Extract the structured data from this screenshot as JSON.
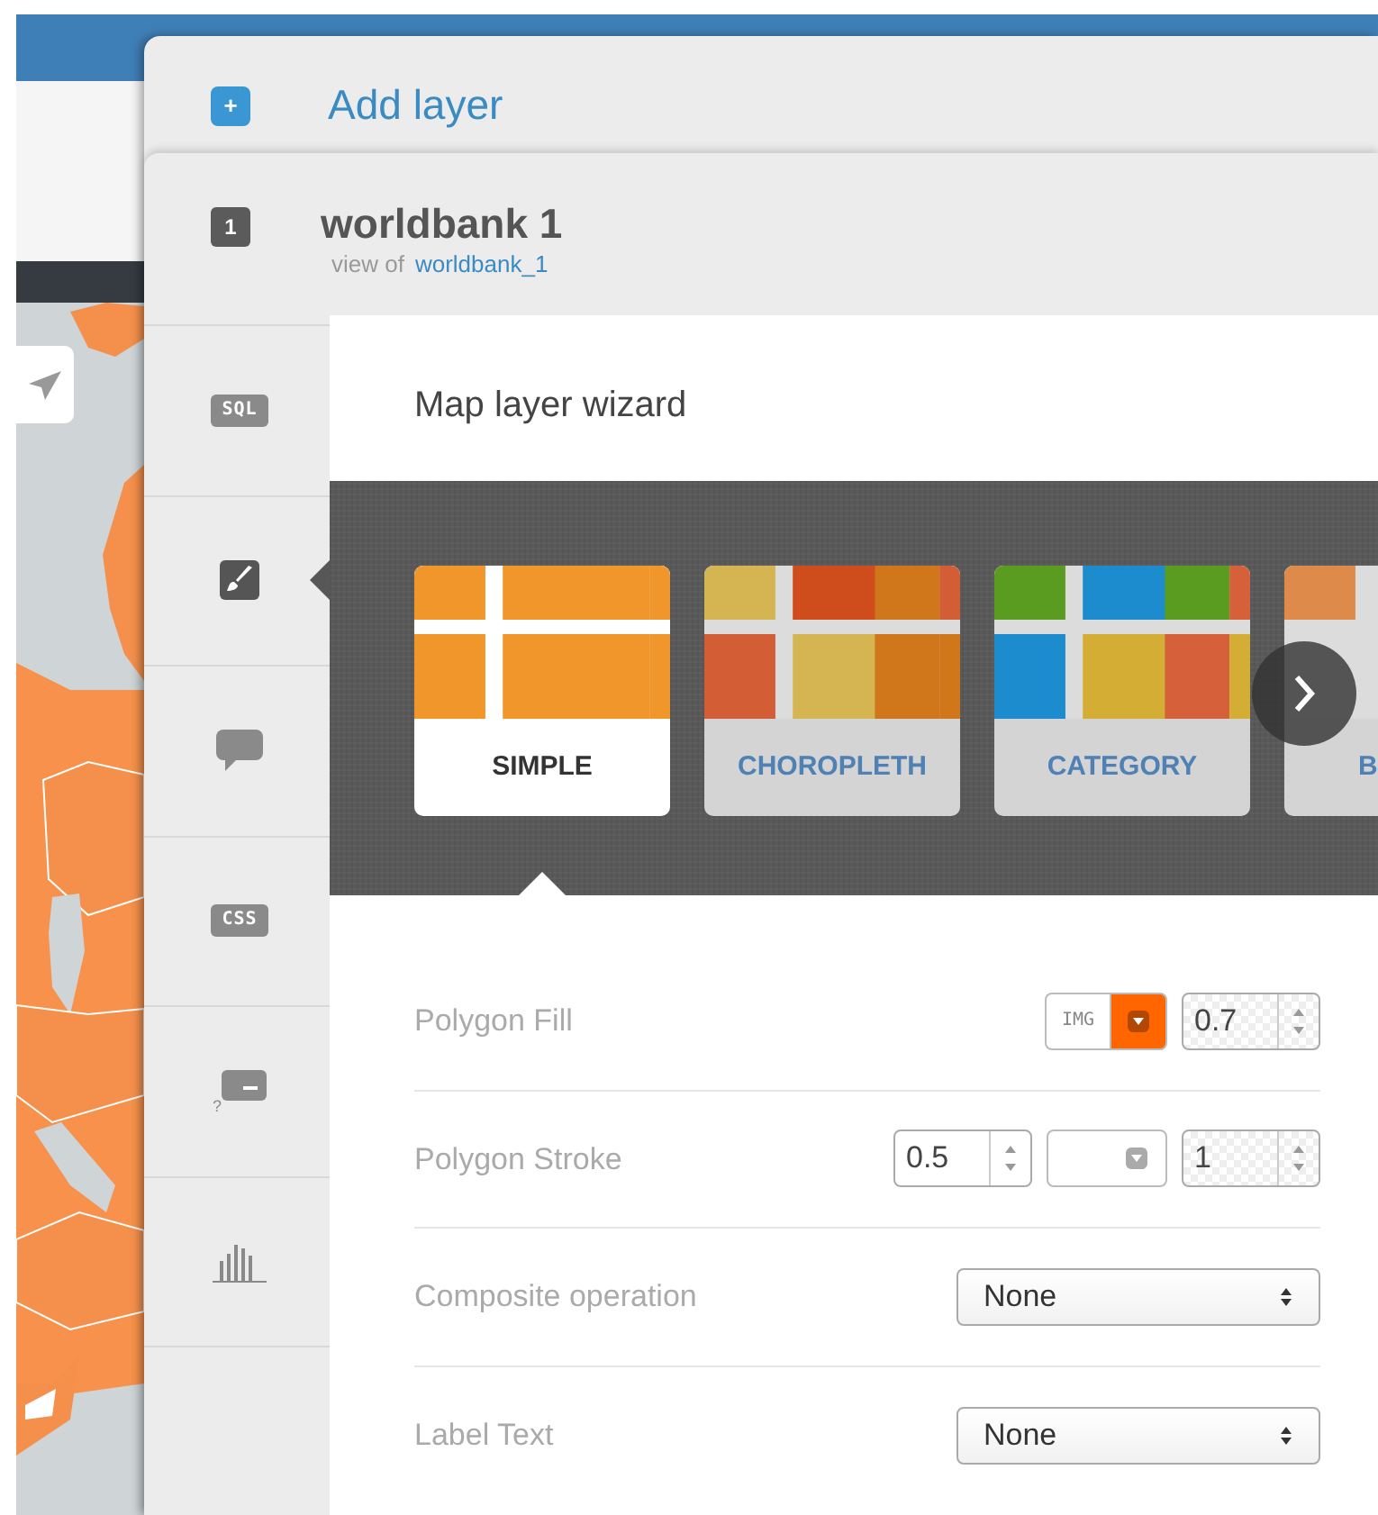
{
  "add_layer": {
    "label": "Add layer",
    "icon": "+"
  },
  "layer": {
    "number": "1",
    "title": "worldbank 1",
    "view_of": "view of",
    "source": "worldbank_1"
  },
  "sidebar": {
    "items": [
      {
        "kind": "sql",
        "label": "SQL",
        "selected": false
      },
      {
        "kind": "style",
        "selected": true
      },
      {
        "kind": "infowindow",
        "selected": false
      },
      {
        "kind": "css",
        "label": "CSS",
        "selected": false
      },
      {
        "kind": "legend",
        "label": "?",
        "selected": false
      },
      {
        "kind": "chart",
        "selected": false
      }
    ]
  },
  "wizard": {
    "title": "Map layer wizard",
    "types": [
      {
        "label": "SIMPLE",
        "selected": true
      },
      {
        "label": "CHOROPLETH",
        "selected": false
      },
      {
        "label": "CATEGORY",
        "selected": false
      },
      {
        "label": "B",
        "selected": false
      }
    ],
    "properties": [
      {
        "label": "Polygon Fill",
        "controls": [
          {
            "label": "IMG"
          },
          {
            "kind": "color",
            "color": "#ff6600"
          },
          {
            "kind": "opacity",
            "value": "0.7"
          }
        ]
      },
      {
        "label": "Polygon Stroke",
        "controls": [
          {
            "kind": "number",
            "value": "0.5"
          },
          {
            "kind": "color",
            "color": "#ffffff"
          },
          {
            "kind": "opacity",
            "value": "1"
          }
        ]
      },
      {
        "label": "Composite operation",
        "controls": [
          {
            "kind": "select",
            "value": "None"
          }
        ]
      },
      {
        "label": "Label Text",
        "controls": [
          {
            "kind": "select",
            "value": "None"
          }
        ]
      }
    ]
  }
}
